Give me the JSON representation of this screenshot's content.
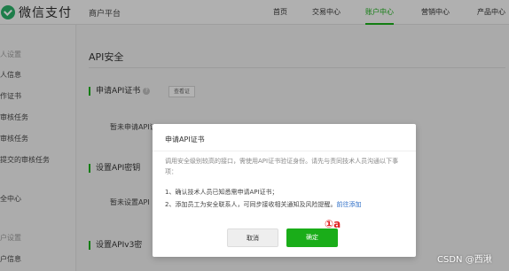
{
  "header": {
    "logo_text": "微信支付",
    "merchant_platform": "商户平台",
    "nav": [
      {
        "label": "首页"
      },
      {
        "label": "交易中心"
      },
      {
        "label": "账户中心"
      },
      {
        "label": "营销中心"
      },
      {
        "label": "产品中心"
      }
    ],
    "active_nav": "账户中心",
    "accent_color": "#1aad19"
  },
  "sidebar": {
    "items": [
      {
        "label": "人设置"
      },
      {
        "label": "人信息"
      },
      {
        "label": "作证书"
      },
      {
        "label": "审核任务"
      },
      {
        "label": "审核任务"
      },
      {
        "label": "提交的审核任务"
      },
      {
        "label": "全中心"
      },
      {
        "label": "户设置"
      },
      {
        "label": "户信息"
      }
    ]
  },
  "main": {
    "page_title": "API安全",
    "sections": [
      {
        "title": "申请API证书",
        "button": "查看证",
        "row": "暂未申请API证"
      },
      {
        "title": "设置API密钥",
        "row": "暂未设置API"
      },
      {
        "title": "设置APIv3密"
      }
    ]
  },
  "dialog": {
    "title": "申请API证书",
    "description": "调用安全级别较高的接口，需使用API证书验证身份。请先与责同技术人员沟通以下事项：",
    "step1": "1、确认技术人员已知悉需申请API证书；",
    "step2_prefix": "2、添加员工为安全联系人，可同步接收相关通知及风险提醒。",
    "step2_link": "前往添加",
    "cancel_label": "取消",
    "confirm_label": "确定"
  },
  "annotation": "①a",
  "watermark": "CSDN @西湫"
}
